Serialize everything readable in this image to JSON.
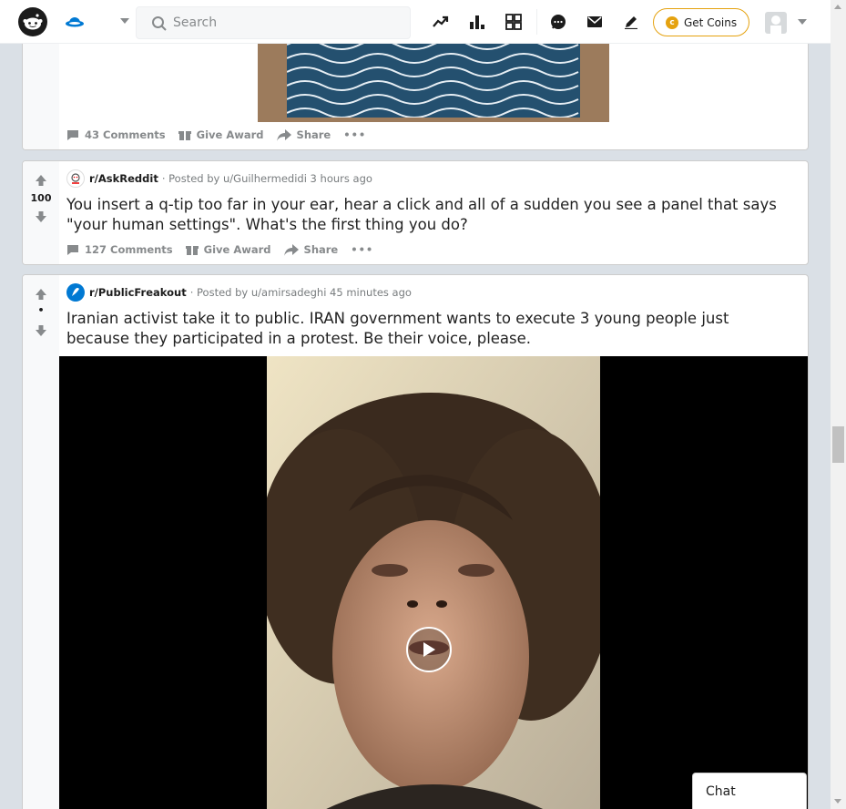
{
  "header": {
    "search_placeholder": "Search",
    "coins_label": "Get Coins",
    "icons": [
      "reddit-logo",
      "home-icon",
      "popular-icon",
      "leaderboard-icon",
      "rpan-icon",
      "chat-icon",
      "mail-icon",
      "create-post-icon"
    ]
  },
  "posts": [
    {
      "actions": {
        "comments": "43 Comments",
        "award": "Give Award",
        "share": "Share",
        "more": "•••"
      }
    },
    {
      "subreddit": "r/AskReddit",
      "posted_by": "· Posted by u/Guilhermedidi 3 hours ago",
      "score": "100",
      "title": "You insert a q-tip too far in your ear, hear a click and all of a sudden you see a panel that says \"your human settings\". What's the first thing you do?",
      "actions": {
        "comments": "127 Comments",
        "award": "Give Award",
        "share": "Share",
        "more": "•••"
      }
    },
    {
      "subreddit": "r/PublicFreakout",
      "posted_by": "· Posted by u/amirsadeghi 45 minutes ago",
      "score": "•",
      "title": "Iranian activist take it to public. IRAN government wants to execute 3 young people just because they participated in a protest. Be their voice, please."
    }
  ],
  "chat_label": "Chat",
  "colors": {
    "accent": "#0079d3",
    "coin": "#e5a20f",
    "upvote": "#878a8c"
  }
}
